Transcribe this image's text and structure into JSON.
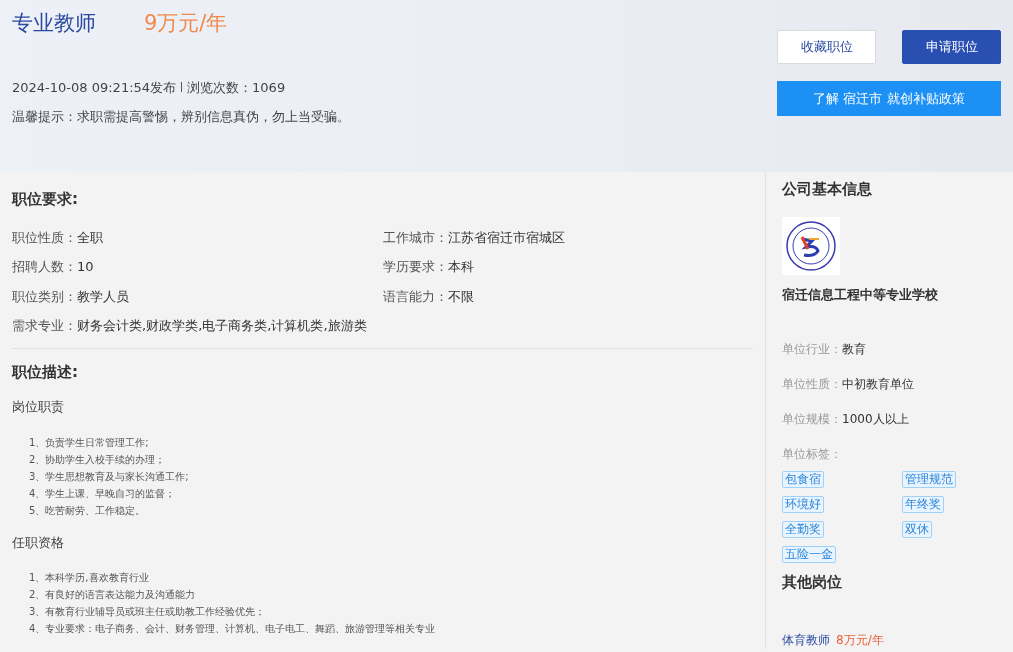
{
  "job": {
    "title": "专业教师",
    "salary": "9万元/年",
    "posted": "2024-10-08 09:21:54发布",
    "views_label": "浏览次数：",
    "views": "1069",
    "notice": "温馨提示：求职需提高警惕，辨别信息真伪，勿上当受骗。"
  },
  "actions": {
    "buttons": [
      {
        "label": "收藏职位",
        "kind": "outline"
      },
      {
        "label": "申请职位",
        "kind": "primary"
      }
    ],
    "policy_button": "了解 宿迁市 就创补贴政策"
  },
  "requirements": {
    "heading": "职位要求:",
    "fields": [
      {
        "label": "职位性质：",
        "value": "全职"
      },
      {
        "label": "工作城市：",
        "value": "江苏省宿迁市宿城区"
      },
      {
        "label": "招聘人数：",
        "value": "10"
      },
      {
        "label": "学历要求：",
        "value": "本科"
      },
      {
        "label": "职位类别：",
        "value": "教学人员"
      },
      {
        "label": "语言能力：",
        "value": "不限"
      }
    ],
    "major": {
      "label": "需求专业：",
      "value": "财务会计类,财政学类,电子商务类,计算机类,旅游类"
    }
  },
  "description": {
    "heading": "职位描述:",
    "sections": [
      {
        "title": "岗位职责",
        "items": [
          "1、负责学生日常管理工作;",
          "2、协助学生入校手续的办理；",
          "3、学生思想教育及与家长沟通工作;",
          "4、学生上课、早晚自习的监督；",
          "5、吃苦耐劳、工作稳定。"
        ]
      },
      {
        "title": "任职资格",
        "items": [
          "1、本科学历,喜欢教育行业",
          "2、有良好的语言表达能力及沟通能力",
          "3、有教育行业辅导员或班主任或助教工作经验优先；",
          "4、专业要求：电子商务、会计、财务管理、计算机、电子电工、舞蹈、旅游管理等相关专业"
        ]
      }
    ]
  },
  "company": {
    "heading": "公司基本信息",
    "name": "宿迁信息工程中等专业学校",
    "fields": [
      {
        "label": "单位行业：",
        "value": "教育"
      },
      {
        "label": "单位性质：",
        "value": "中初教育单位"
      },
      {
        "label": "单位规模：",
        "value": "1000人以上"
      }
    ],
    "tags_label": "单位标签：",
    "tags": [
      "包食宿",
      "管理规范",
      "环境好",
      "年终奖",
      "全勤奖",
      "双休",
      "五险一金"
    ]
  },
  "other_jobs": {
    "heading": "其他岗位",
    "items": [
      {
        "title": "体育教师",
        "salary": "8万元/年"
      }
    ]
  }
}
